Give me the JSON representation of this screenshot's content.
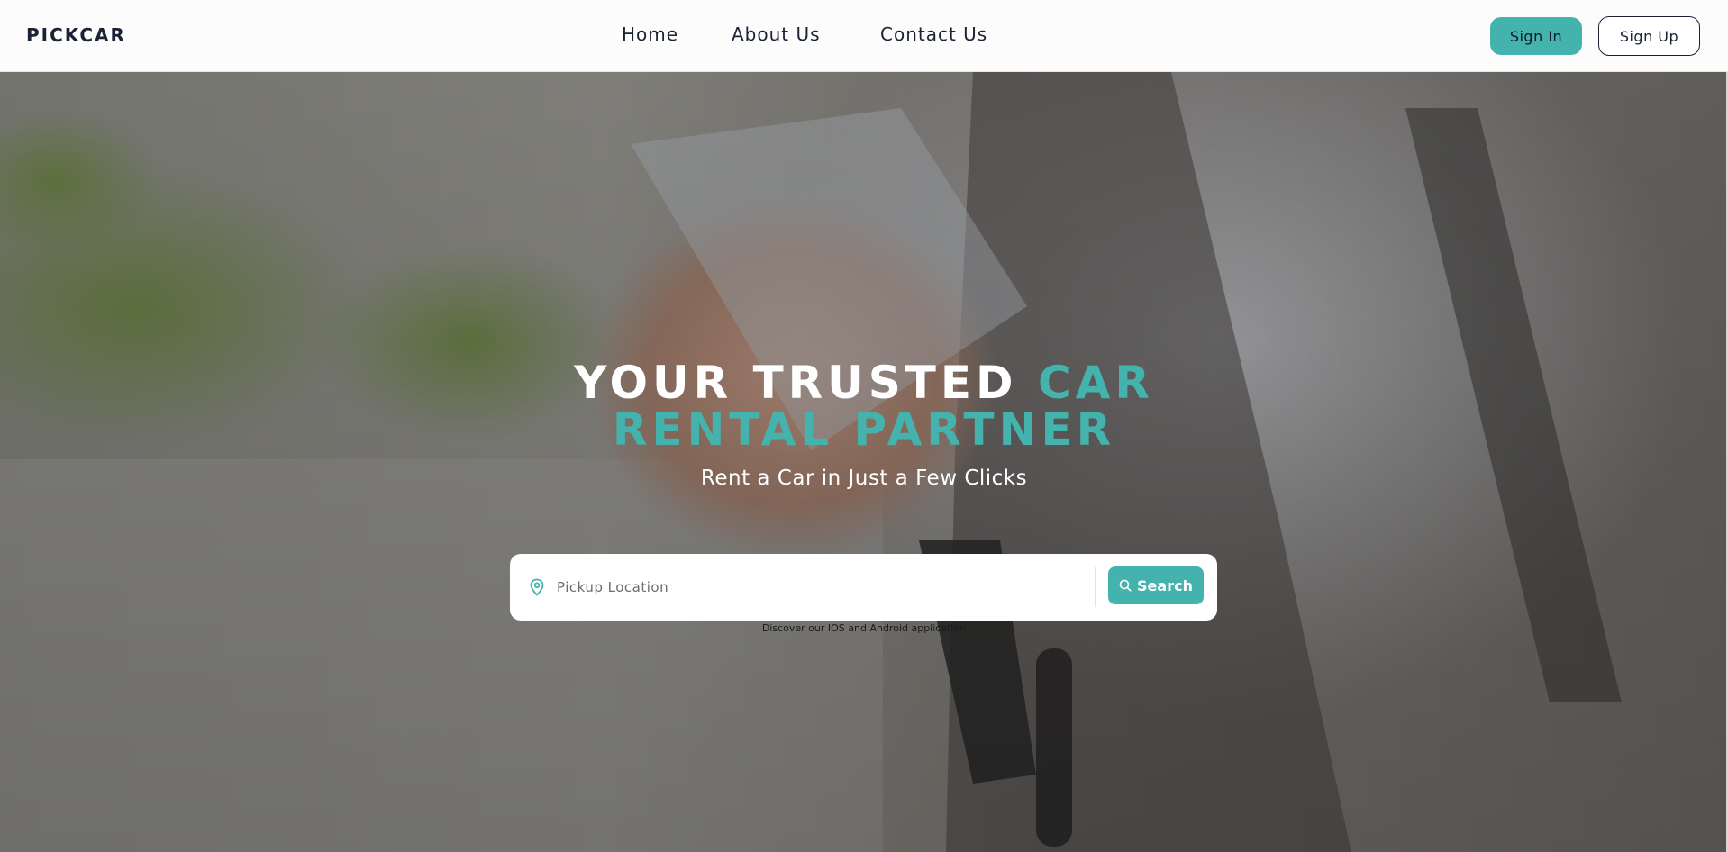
{
  "header": {
    "logo": "PICKCAR",
    "nav": [
      {
        "label": "Home"
      },
      {
        "label": "About Us"
      },
      {
        "label": "Contact Us"
      }
    ],
    "signin_label": "Sign In",
    "signup_label": "Sign Up"
  },
  "hero": {
    "title_part1": "YOUR TRUSTED ",
    "title_part2": "CAR",
    "title_line2": "RENTAL PARTNER",
    "subtitle": "Rent a Car in Just a Few Clicks",
    "search_placeholder": "Pickup Location",
    "search_label": "Search",
    "app_note": "Discover our IOS and Android application"
  },
  "colors": {
    "accent": "#45b3ad",
    "dark": "#1b2233",
    "white": "#ffffff"
  },
  "icons": {
    "pin": "location-pin-icon",
    "search": "search-icon"
  }
}
